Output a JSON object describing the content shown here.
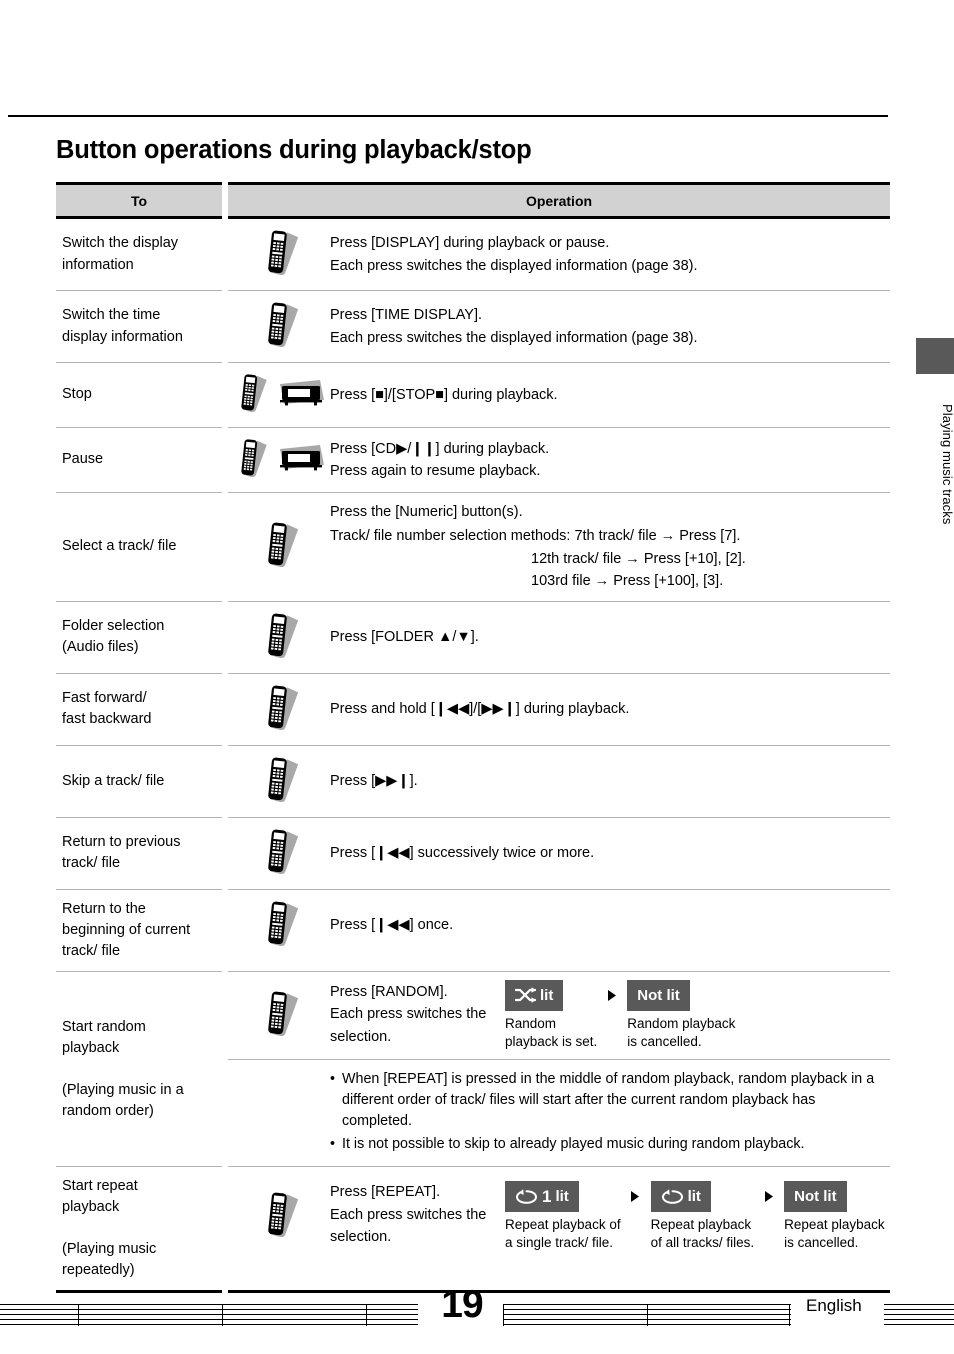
{
  "page": {
    "title": "Button operations during playback/stop",
    "number": "19",
    "language": "English",
    "side_tab_label": "Playing music tracks",
    "accent_dark": "#595959",
    "header_fill": "#d2d2d2"
  },
  "table": {
    "headers": {
      "to": "To",
      "operation": "Operation"
    },
    "rows": [
      {
        "to": "Switch the display\ninformation",
        "icons": [
          "remote-icon"
        ],
        "lines": [
          "Press [DISPLAY] during playback or pause.",
          "Each press switches the displayed information (page 38)."
        ]
      },
      {
        "to": "Switch the time\ndisplay information",
        "icons": [
          "remote-icon"
        ],
        "lines": [
          "Press [TIME DISPLAY].",
          "Each press switches the displayed information (page 38)."
        ]
      },
      {
        "to": "Stop",
        "icons": [
          "remote-icon",
          "device-icon"
        ],
        "lines": [
          "Press [■]/[STOP■] during playback."
        ]
      },
      {
        "to": "Pause",
        "icons": [
          "remote-icon",
          "device-icon"
        ],
        "lines": [
          "Press [CD▶/❙❙] during playback.",
          "Press again to resume playback."
        ]
      },
      {
        "to": "Select a track/ file",
        "icons": [
          "remote-icon"
        ],
        "lines": [
          "Press the [Numeric] button(s)."
        ],
        "methods": {
          "label": "Track/ file number selection methods:",
          "items": [
            "7th track/ file → Press [7].",
            "12th track/ file → Press [+10], [2].",
            "103rd file → Press [+100], [3]."
          ]
        }
      },
      {
        "to": "Folder selection\n(Audio files)",
        "icons": [
          "remote-icon"
        ],
        "lines": [
          "Press [FOLDER ▲/▼]."
        ]
      },
      {
        "to": "Fast forward/\nfast backward",
        "icons": [
          "remote-icon"
        ],
        "lines": [
          "Press and hold [❙◀◀]/[▶▶❙] during playback."
        ]
      },
      {
        "to": "Skip a track/ file",
        "icons": [
          "remote-icon"
        ],
        "lines": [
          "Press [▶▶❙]."
        ]
      },
      {
        "to": "Return to previous\ntrack/ file",
        "icons": [
          "remote-icon"
        ],
        "lines": [
          "Press [❙◀◀] successively twice or more."
        ]
      },
      {
        "to": "Return to the\nbeginning of current\ntrack/ file",
        "icons": [
          "remote-icon"
        ],
        "lines": [
          "Press [❙◀◀] once."
        ]
      }
    ],
    "random_row": {
      "to": "Start random\nplayback\n\n(Playing music in a\nrandom order)",
      "icons": [
        "remote-icon"
      ],
      "lines": [
        "Press [RANDOM].",
        "Each press switches the",
        "selection."
      ],
      "states": [
        {
          "icon": "shuffle-icon",
          "label": "lit",
          "caption": "Random\nplayback is set."
        },
        {
          "icon": "none",
          "label": "Not lit",
          "caption": "Random playback\nis cancelled."
        }
      ],
      "notes": [
        "When [REPEAT] is pressed in the middle of random playback, random playback in a different order of track/ files will start after the current random playback has completed.",
        "It is not possible to skip to already played music during random playback."
      ]
    },
    "repeat_row": {
      "to": "Start repeat\nplayback\n\n(Playing music\nrepeatedly)",
      "icons": [
        "remote-icon"
      ],
      "lines": [
        "Press [REPEAT].",
        "Each press switches the",
        "selection."
      ],
      "states": [
        {
          "icon": "repeat-one-icon",
          "label": "lit",
          "prefix": "1",
          "caption": "Repeat playback of\na single track/ file."
        },
        {
          "icon": "repeat-icon",
          "label": "lit",
          "caption": "Repeat playback\nof all tracks/ files."
        },
        {
          "icon": "none",
          "label": "Not lit",
          "caption": "Repeat playback\nis cancelled."
        }
      ]
    }
  }
}
